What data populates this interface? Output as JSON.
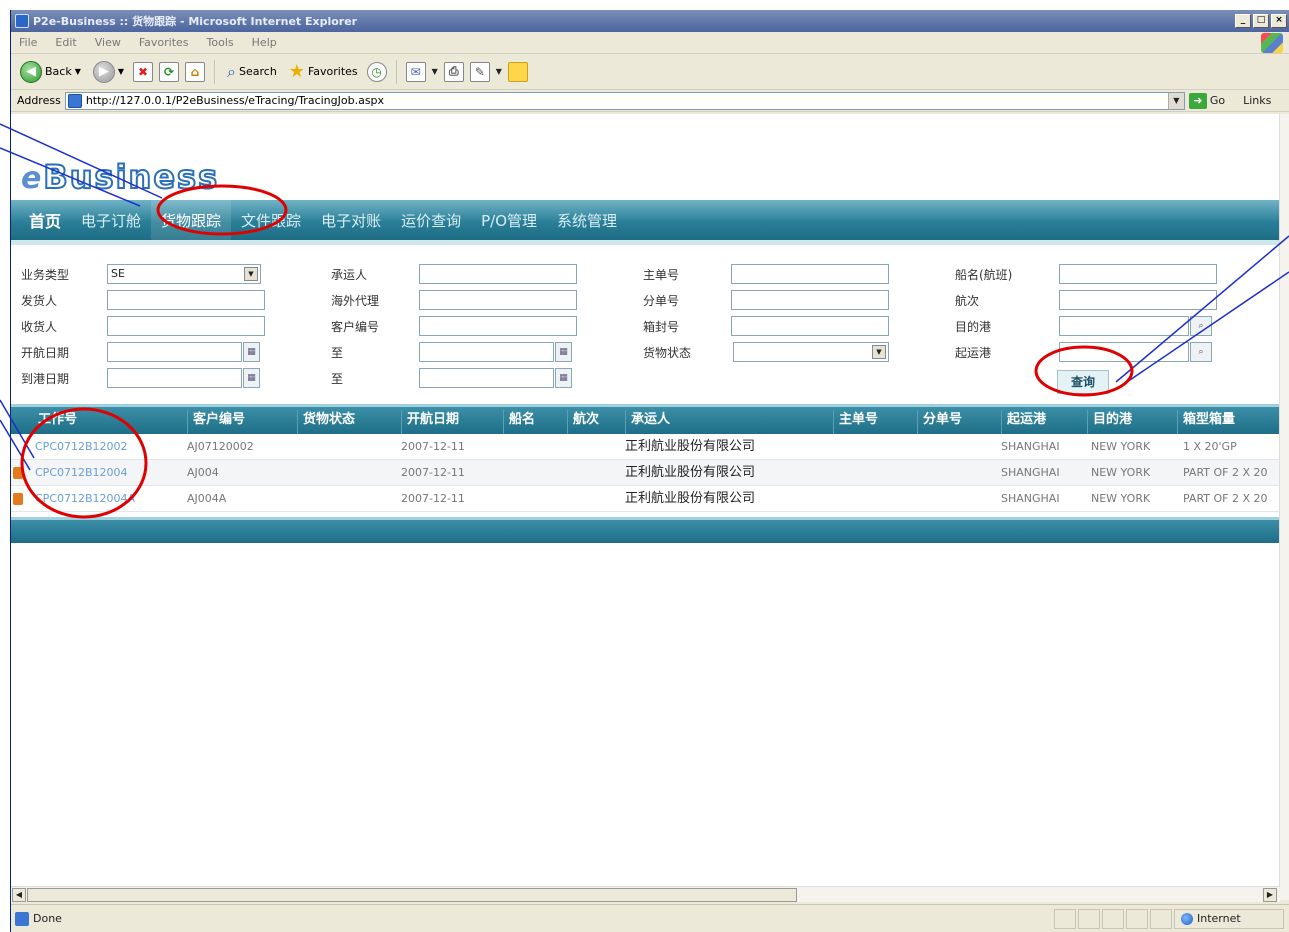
{
  "window": {
    "title": "P2e-Business :: 货物跟踪 - Microsoft Internet Explorer",
    "controls": [
      "_",
      "□",
      "×"
    ]
  },
  "menu": [
    "File",
    "Edit",
    "View",
    "Favorites",
    "Tools",
    "Help"
  ],
  "toolbar": {
    "back": "Back",
    "search": "Search",
    "favorites": "Favorites"
  },
  "address": {
    "label": "Address",
    "url": "http://127.0.0.1/P2eBusiness/eTracing/TracingJob.aspx",
    "go": "Go",
    "links": "Links"
  },
  "site": {
    "logo_e": "e",
    "logo_word": "Business",
    "nav": [
      "首页",
      "电子订舱",
      "货物跟踪",
      "文件跟踪",
      "电子对账",
      "运价查询",
      "P/O管理",
      "系统管理"
    ]
  },
  "search_form": {
    "business_type": {
      "label": "业务类型",
      "value": "SE"
    },
    "shipper": {
      "label": "发货人"
    },
    "consignee": {
      "label": "收货人"
    },
    "sail_date": {
      "label": "开航日期"
    },
    "arrival_date": {
      "label": "到港日期"
    },
    "carrier": {
      "label": "承运人"
    },
    "overseas_agent": {
      "label": "海外代理"
    },
    "customer_no": {
      "label": "客户编号"
    },
    "to1": {
      "label": "至"
    },
    "to2": {
      "label": "至"
    },
    "master_no": {
      "label": "主单号"
    },
    "house_no": {
      "label": "分单号"
    },
    "cabinet_no": {
      "label": "箱封号"
    },
    "cargo_status": {
      "label": "货物状态",
      "value": ""
    },
    "vessel": {
      "label": "船名(航班)"
    },
    "voyage": {
      "label": "航次"
    },
    "dest_port": {
      "label": "目的港"
    },
    "origin_port": {
      "label": "起运港"
    },
    "query_button": "查询"
  },
  "results": {
    "headers": [
      "工作号",
      "客户编号",
      "货物状态",
      "开航日期",
      "船名",
      "航次",
      "承运人",
      "主单号",
      "分单号",
      "起运港",
      "目的港",
      "箱型箱量"
    ],
    "rows": [
      {
        "job": "CPC0712B12002",
        "customer": "AJ07120002",
        "status": "",
        "sail_date": "2007-12-11",
        "vessel": "",
        "voyage": "",
        "carrier": "正利航业股份有限公司",
        "master": "",
        "house": "",
        "origin": "SHANGHAI",
        "dest": "NEW YORK",
        "container": "1 X 20'GP"
      },
      {
        "job": "CPC0712B12004",
        "customer": "AJ004",
        "status": "",
        "sail_date": "2007-12-11",
        "vessel": "",
        "voyage": "",
        "carrier": "正利航业股份有限公司",
        "master": "",
        "house": "",
        "origin": "SHANGHAI",
        "dest": "NEW YORK",
        "container": "PART OF 2 X 20"
      },
      {
        "job": "CPC0712B12004A",
        "customer": "AJ004A",
        "status": "",
        "sail_date": "2007-12-11",
        "vessel": "",
        "voyage": "",
        "carrier": "正利航业股份有限公司",
        "master": "",
        "house": "",
        "origin": "SHANGHAI",
        "dest": "NEW YORK",
        "container": "PART OF 2 X 20"
      }
    ]
  },
  "status_bar": {
    "left": "Done",
    "zone": "Internet"
  },
  "colors": {
    "nav_bar": "#2b7f98",
    "annotation": "#e00000",
    "callout_line": "#1a2fcc",
    "link": "#6a9fd4"
  }
}
